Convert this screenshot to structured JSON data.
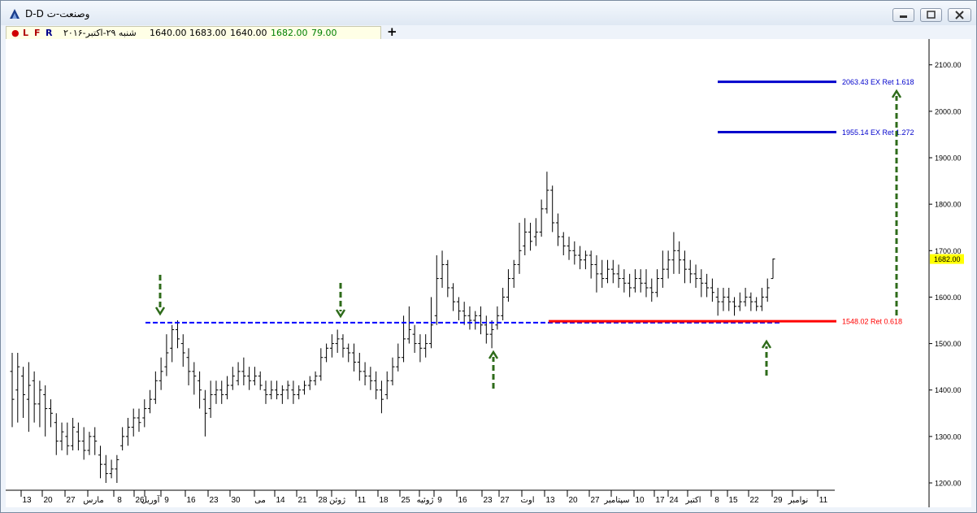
{
  "window": {
    "title": "وصنعت-ت D-D"
  },
  "info": {
    "markers": [
      "L",
      "F",
      "R"
    ],
    "date": "شنبه ۲۹-اکتبر-۲۰۱۶",
    "open": "1640.00",
    "high": "1683.00",
    "low": "1640.00",
    "close": "1682.00",
    "change": "79.00"
  },
  "toolbar": {
    "add_symbol": "+"
  },
  "colors": {
    "background": "#ffffff",
    "bars": "#000000",
    "support": "#0000ff",
    "target": "#0000cc",
    "retracement": "#ff0000",
    "arrows": "#2e6b1a",
    "price_tag": "#ffff00"
  },
  "chart_data": {
    "type": "ohlc",
    "price_axis": {
      "min": 1180,
      "max": 2140,
      "ticks": [
        "1200.00",
        "1300.00",
        "1400.00",
        "1500.00",
        "1600.00",
        "1700.00",
        "1800.00",
        "1900.00",
        "2000.00",
        "2100.00"
      ]
    },
    "date_axis": [
      "13",
      "20",
      "27",
      "مارس",
      "8",
      "26",
      "آوریل",
      "9",
      "16",
      "23",
      "30",
      "می",
      "14",
      "21",
      "28",
      "ژوئن",
      "11",
      "18",
      "25",
      "ژوئیه",
      "9",
      "16",
      "23",
      "27",
      "اوت",
      "13",
      "20",
      "27",
      "سپتامبر",
      "10",
      "17",
      "24",
      "اکتبر",
      "8",
      "15",
      "22",
      "29",
      "نوامبر",
      "11"
    ],
    "last_price": "1682.00",
    "levels": [
      {
        "label": "2063.43 EX Ret 1.618",
        "value": 2063.43,
        "style": "solid",
        "color": "#0000cc"
      },
      {
        "label": "1955.14 EX Ret 1.272",
        "value": 1955.14,
        "style": "solid",
        "color": "#0000cc"
      },
      {
        "label": "1548.02 Ret 0.618",
        "value": 1548.02,
        "style": "solid",
        "color": "#ff0000"
      },
      {
        "label": "",
        "value": 1545,
        "style": "dashed",
        "color": "#0000ff"
      }
    ],
    "bars": [
      [
        1440,
        1380,
        1480,
        1320
      ],
      [
        1400,
        1450,
        1480,
        1330
      ],
      [
        1430,
        1390,
        1450,
        1340
      ],
      [
        1380,
        1410,
        1460,
        1310
      ],
      [
        1420,
        1370,
        1440,
        1330
      ],
      [
        1370,
        1400,
        1420,
        1320
      ],
      [
        1390,
        1360,
        1410,
        1300
      ],
      [
        1360,
        1350,
        1380,
        1320
      ],
      [
        1330,
        1290,
        1350,
        1260
      ],
      [
        1290,
        1310,
        1330,
        1270
      ],
      [
        1300,
        1280,
        1330,
        1260
      ],
      [
        1280,
        1320,
        1340,
        1270
      ],
      [
        1310,
        1290,
        1330,
        1270
      ],
      [
        1290,
        1270,
        1320,
        1250
      ],
      [
        1270,
        1300,
        1310,
        1260
      ],
      [
        1300,
        1290,
        1320,
        1260
      ],
      [
        1260,
        1240,
        1280,
        1210
      ],
      [
        1240,
        1220,
        1260,
        1200
      ],
      [
        1220,
        1230,
        1250,
        1210
      ],
      [
        1230,
        1250,
        1260,
        1200
      ],
      [
        1280,
        1300,
        1320,
        1270
      ],
      [
        1300,
        1320,
        1340,
        1280
      ],
      [
        1320,
        1340,
        1360,
        1300
      ],
      [
        1340,
        1330,
        1360,
        1310
      ],
      [
        1340,
        1360,
        1380,
        1320
      ],
      [
        1360,
        1380,
        1400,
        1350
      ],
      [
        1380,
        1420,
        1440,
        1370
      ],
      [
        1420,
        1440,
        1470,
        1400
      ],
      [
        1450,
        1480,
        1520,
        1430
      ],
      [
        1490,
        1530,
        1540,
        1460
      ],
      [
        1530,
        1510,
        1550,
        1490
      ],
      [
        1500,
        1480,
        1520,
        1450
      ],
      [
        1470,
        1440,
        1490,
        1410
      ],
      [
        1440,
        1430,
        1460,
        1390
      ],
      [
        1420,
        1400,
        1440,
        1360
      ],
      [
        1380,
        1350,
        1400,
        1300
      ],
      [
        1360,
        1390,
        1420,
        1340
      ],
      [
        1390,
        1400,
        1420,
        1370
      ],
      [
        1400,
        1390,
        1420,
        1370
      ],
      [
        1390,
        1410,
        1430,
        1380
      ],
      [
        1410,
        1430,
        1450,
        1400
      ],
      [
        1420,
        1440,
        1460,
        1410
      ],
      [
        1440,
        1430,
        1470,
        1410
      ],
      [
        1430,
        1420,
        1450,
        1400
      ],
      [
        1420,
        1430,
        1450,
        1410
      ],
      [
        1430,
        1410,
        1440,
        1400
      ],
      [
        1400,
        1390,
        1420,
        1370
      ],
      [
        1390,
        1400,
        1420,
        1380
      ],
      [
        1400,
        1390,
        1420,
        1380
      ],
      [
        1390,
        1400,
        1410,
        1370
      ],
      [
        1400,
        1410,
        1420,
        1380
      ],
      [
        1400,
        1390,
        1420,
        1370
      ],
      [
        1390,
        1400,
        1410,
        1380
      ],
      [
        1400,
        1410,
        1420,
        1390
      ],
      [
        1410,
        1420,
        1430,
        1400
      ],
      [
        1420,
        1430,
        1440,
        1410
      ],
      [
        1430,
        1470,
        1490,
        1420
      ],
      [
        1470,
        1490,
        1500,
        1460
      ],
      [
        1490,
        1500,
        1520,
        1470
      ],
      [
        1500,
        1510,
        1530,
        1480
      ],
      [
        1510,
        1490,
        1520,
        1470
      ],
      [
        1490,
        1480,
        1500,
        1460
      ],
      [
        1480,
        1460,
        1500,
        1440
      ],
      [
        1460,
        1440,
        1480,
        1420
      ],
      [
        1440,
        1430,
        1460,
        1410
      ],
      [
        1430,
        1420,
        1450,
        1400
      ],
      [
        1420,
        1400,
        1440,
        1380
      ],
      [
        1400,
        1380,
        1420,
        1350
      ],
      [
        1390,
        1420,
        1440,
        1380
      ],
      [
        1420,
        1450,
        1470,
        1410
      ],
      [
        1450,
        1470,
        1500,
        1440
      ],
      [
        1470,
        1510,
        1560,
        1460
      ],
      [
        1510,
        1530,
        1580,
        1500
      ],
      [
        1520,
        1500,
        1540,
        1480
      ],
      [
        1500,
        1490,
        1520,
        1460
      ],
      [
        1490,
        1500,
        1520,
        1470
      ],
      [
        1500,
        1540,
        1600,
        1490
      ],
      [
        1560,
        1640,
        1690,
        1540
      ],
      [
        1640,
        1670,
        1700,
        1620
      ],
      [
        1670,
        1620,
        1680,
        1600
      ],
      [
        1620,
        1590,
        1630,
        1570
      ],
      [
        1590,
        1570,
        1600,
        1550
      ],
      [
        1570,
        1560,
        1590,
        1540
      ],
      [
        1560,
        1550,
        1580,
        1530
      ],
      [
        1550,
        1560,
        1570,
        1530
      ],
      [
        1560,
        1540,
        1580,
        1520
      ],
      [
        1540,
        1520,
        1560,
        1500
      ],
      [
        1520,
        1530,
        1550,
        1490
      ],
      [
        1540,
        1560,
        1580,
        1530
      ],
      [
        1560,
        1600,
        1620,
        1550
      ],
      [
        1600,
        1640,
        1660,
        1590
      ],
      [
        1640,
        1670,
        1680,
        1620
      ],
      [
        1670,
        1700,
        1760,
        1650
      ],
      [
        1710,
        1740,
        1770,
        1690
      ],
      [
        1740,
        1720,
        1760,
        1700
      ],
      [
        1730,
        1740,
        1770,
        1710
      ],
      [
        1740,
        1790,
        1810,
        1730
      ],
      [
        1790,
        1830,
        1870,
        1780
      ],
      [
        1830,
        1760,
        1840,
        1740
      ],
      [
        1760,
        1730,
        1780,
        1710
      ],
      [
        1730,
        1710,
        1740,
        1690
      ],
      [
        1710,
        1700,
        1730,
        1680
      ],
      [
        1700,
        1690,
        1720,
        1670
      ],
      [
        1690,
        1680,
        1710,
        1660
      ],
      [
        1680,
        1690,
        1700,
        1660
      ],
      [
        1690,
        1670,
        1700,
        1640
      ],
      [
        1670,
        1650,
        1690,
        1610
      ],
      [
        1650,
        1640,
        1680,
        1620
      ],
      [
        1640,
        1660,
        1680,
        1630
      ],
      [
        1660,
        1650,
        1680,
        1630
      ],
      [
        1650,
        1640,
        1670,
        1620
      ],
      [
        1640,
        1630,
        1660,
        1610
      ],
      [
        1630,
        1620,
        1650,
        1600
      ],
      [
        1620,
        1640,
        1660,
        1610
      ],
      [
        1640,
        1630,
        1660,
        1610
      ],
      [
        1630,
        1620,
        1660,
        1600
      ],
      [
        1620,
        1610,
        1640,
        1590
      ],
      [
        1610,
        1640,
        1660,
        1600
      ],
      [
        1640,
        1660,
        1700,
        1620
      ],
      [
        1660,
        1680,
        1700,
        1640
      ],
      [
        1680,
        1700,
        1740,
        1650
      ],
      [
        1700,
        1680,
        1720,
        1650
      ],
      [
        1680,
        1660,
        1700,
        1630
      ],
      [
        1660,
        1650,
        1680,
        1630
      ],
      [
        1650,
        1640,
        1670,
        1620
      ],
      [
        1640,
        1630,
        1660,
        1600
      ],
      [
        1630,
        1620,
        1650,
        1600
      ],
      [
        1620,
        1610,
        1640,
        1590
      ],
      [
        1600,
        1590,
        1620,
        1560
      ],
      [
        1590,
        1600,
        1620,
        1570
      ],
      [
        1600,
        1590,
        1620,
        1570
      ],
      [
        1590,
        1580,
        1600,
        1560
      ],
      [
        1580,
        1590,
        1610,
        1570
      ],
      [
        1590,
        1600,
        1620,
        1580
      ],
      [
        1600,
        1590,
        1610,
        1570
      ],
      [
        1590,
        1580,
        1600,
        1570
      ],
      [
        1580,
        1600,
        1620,
        1570
      ],
      [
        1600,
        1620,
        1640,
        1590
      ],
      [
        1640,
        1682,
        1683,
        1640
      ]
    ]
  }
}
